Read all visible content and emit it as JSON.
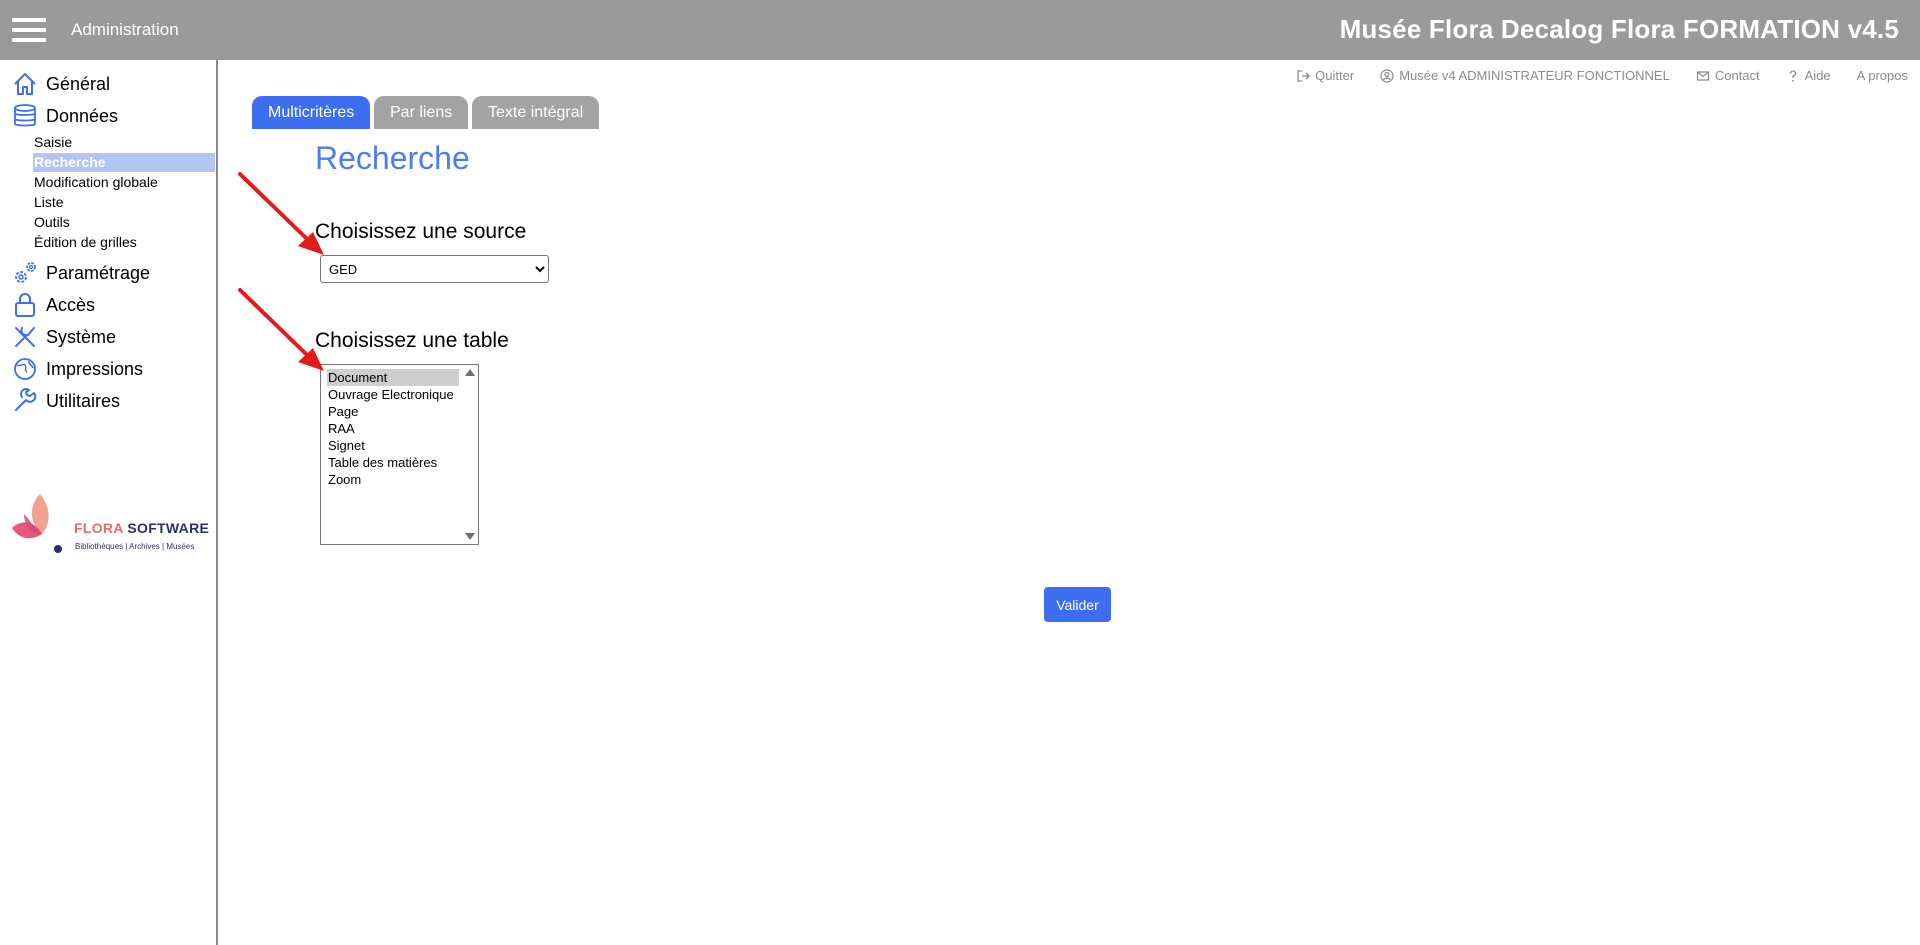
{
  "header": {
    "section_title": "Administration",
    "app_title": "Musée Flora Decalog Flora FORMATION v4.5"
  },
  "sidebar": {
    "items": [
      {
        "label": "Général",
        "icon": "home-icon"
      },
      {
        "label": "Données",
        "icon": "database-icon"
      },
      {
        "label": "Paramétrage",
        "icon": "gears-icon"
      },
      {
        "label": "Accès",
        "icon": "lock-icon"
      },
      {
        "label": "Système",
        "icon": "tools-icon"
      },
      {
        "label": "Impressions",
        "icon": "globe-icon"
      },
      {
        "label": "Utilitaires",
        "icon": "wrench-icon"
      }
    ],
    "subitems": [
      {
        "label": "Saisie"
      },
      {
        "label": "Recherche",
        "active": true
      },
      {
        "label": "Modification globale"
      },
      {
        "label": "Liste"
      },
      {
        "label": "Outils"
      },
      {
        "label": "Édition de grilles"
      }
    ],
    "logo": {
      "brand_part1": "FLORA",
      "brand_part2": "SOFTWARE",
      "tagline": "Bibliothèques | Archives | Musées"
    }
  },
  "util_links": [
    {
      "label": "Quitter",
      "icon": "exit-icon"
    },
    {
      "label": "Musée v4 ADMINISTRATEUR FONCTIONNEL",
      "icon": "user-icon"
    },
    {
      "label": "Contact",
      "icon": "mail-icon"
    },
    {
      "label": "Aide",
      "icon": "help-icon"
    },
    {
      "label": "A propos",
      "icon": ""
    }
  ],
  "tabs": [
    {
      "label": "Multicritères",
      "active": true
    },
    {
      "label": "Par liens",
      "active": false
    },
    {
      "label": "Texte intégral",
      "active": false
    }
  ],
  "main": {
    "title": "Recherche",
    "source_label": "Choisissez une source",
    "source_selected": "GED",
    "table_label": "Choisissez une table",
    "table_options": [
      {
        "label": "Document",
        "selected": true
      },
      {
        "label": "Ouvrage Electronique",
        "selected": false
      },
      {
        "label": "Page",
        "selected": false
      },
      {
        "label": "RAA",
        "selected": false
      },
      {
        "label": "Signet",
        "selected": false
      },
      {
        "label": "Table des matières",
        "selected": false
      },
      {
        "label": "Zoom",
        "selected": false
      }
    ],
    "submit_label": "Valider"
  },
  "colors": {
    "accent": "#3d6ef0",
    "title": "#4a7ef0",
    "topbar": "#9a9a9a",
    "annotation_arrow": "#e31b1b"
  }
}
